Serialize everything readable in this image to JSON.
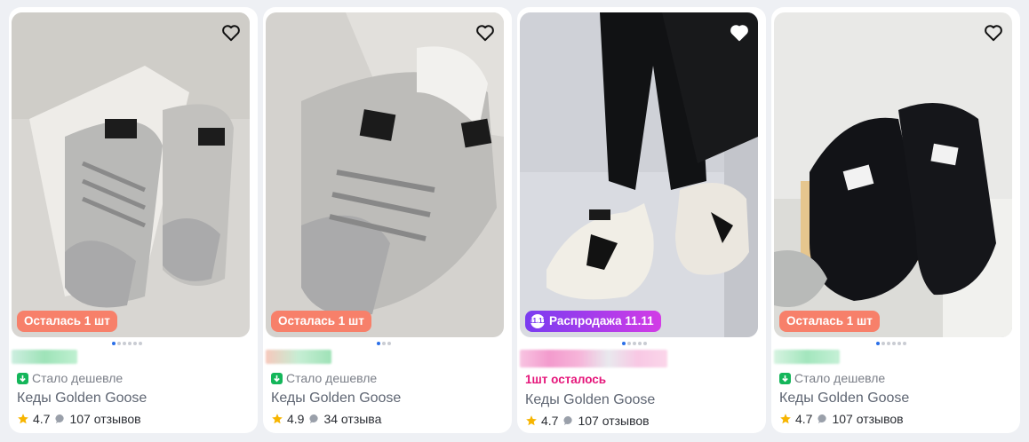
{
  "colors": {
    "page_bg": "#eef0f4",
    "badge_left": "#f7806a",
    "sale_gradient": [
      "#7a3cf0",
      "#d23ce6"
    ],
    "cheaper_icon": "#14b65a",
    "hot_text": "#e5157a",
    "star": "#f7b500",
    "dot_active": "#2b6fe8"
  },
  "products": [
    {
      "badge": "Осталась 1 шт",
      "badge_style": "stock",
      "photo_index": 1,
      "photo_count": 6,
      "promo": "Стало дешевле",
      "promo_style": "cheaper",
      "title": "Кеды Golden Goose",
      "rating": "4.7",
      "reviews": "107 отзывов",
      "shoe_color": "silver"
    },
    {
      "badge": "Осталась 1 шт",
      "badge_style": "stock",
      "photo_index": 1,
      "photo_count": 3,
      "promo": "Стало дешевле",
      "promo_style": "cheaper",
      "title": "Кеды Golden Goose",
      "rating": "4.9",
      "reviews": "34 отзыва",
      "shoe_color": "silver"
    },
    {
      "badge": "Распродажа 11.11",
      "badge_style": "sale",
      "sale_icon_text": "11.11",
      "photo_index": 1,
      "photo_count": 5,
      "promo": "1шт осталось",
      "promo_style": "hot",
      "title": "Кеды Golden Goose",
      "rating": "4.7",
      "reviews": "107 отзывов",
      "shoe_color": "white"
    },
    {
      "badge": "Осталась 1 шт",
      "badge_style": "stock",
      "photo_index": 1,
      "photo_count": 6,
      "promo": "Стало дешевле",
      "promo_style": "cheaper",
      "title": "Кеды Golden Goose",
      "rating": "4.7",
      "reviews": "107 отзывов",
      "shoe_color": "black"
    }
  ]
}
